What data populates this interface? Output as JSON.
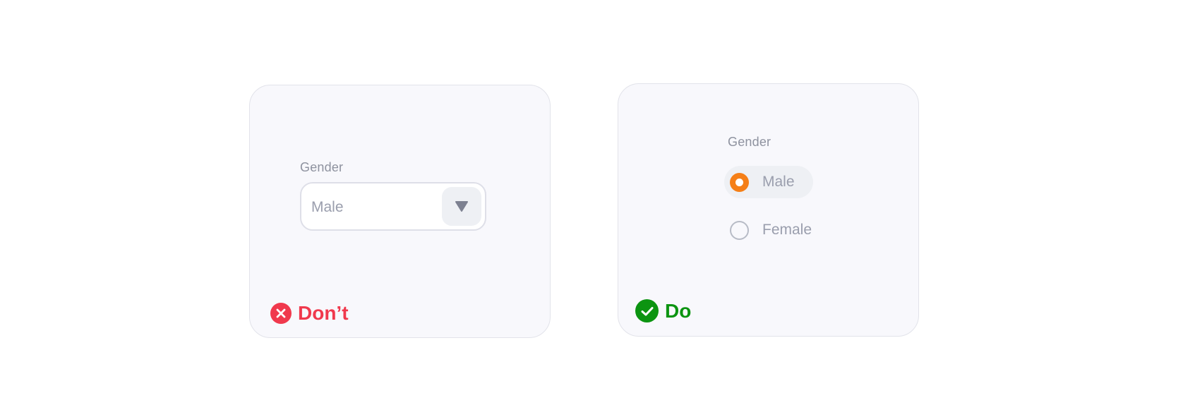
{
  "dont_example": {
    "field_label": "Gender",
    "select_value": "Male",
    "verdict_label": "Don’t",
    "verdict_color": "#f0394d"
  },
  "do_example": {
    "field_label": "Gender",
    "options": [
      {
        "label": "Male",
        "selected": true
      },
      {
        "label": "Female",
        "selected": false
      }
    ],
    "verdict_label": "Do",
    "verdict_color": "#0c9411"
  },
  "colors": {
    "card_bg": "#f8f8fc",
    "accent_radio": "#f57f17",
    "muted_text": "#9a9ead"
  },
  "icons": {
    "dropdown": "triangle-down-icon",
    "dont": "x-circle-icon",
    "do": "check-circle-icon"
  }
}
